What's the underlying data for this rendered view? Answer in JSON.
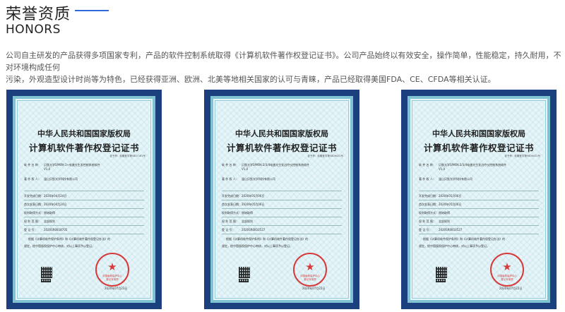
{
  "section": {
    "title_cn": "荣誉资质",
    "title_en": "HONORS",
    "accent_color": "#2f6bd8",
    "description_line1": "公司自主研发的产品获得多项国家专利，产品的软件控制系统取得《计算机软件著作权登记证书》。公司产品始终以有效安全，操作简单，性能稳定，持久耐用，不对环境构成任何",
    "description_line2": "污染，外观造型设计时尚等为特色，已经获得亚洲、欧洲、北美等地相关国家的认可与青睐，产品已经取得美国FDA、CE、CFDA等相关认证。"
  },
  "certificates": [
    {
      "org": "中华人民共和国国家版权局",
      "title": "计算机软件著作权登记证书",
      "reg_no": "证书号：软著登字第5807161号",
      "software_label": "软 件 名 称：",
      "software_name": "贝肽光学SPARK-1+电激光生发控制系统软件",
      "version": "V1.0",
      "owner_label": "著 作 权 人：",
      "owner": "温山贝肽光学科技有限公司",
      "dev_done_label": "开发完成日期：",
      "dev_done": "2020年04月24日",
      "first_pub_label": "首次发表日期：",
      "first_pub": "2020年04月24日",
      "acq_label": "权利取得方式：",
      "acq": "原始取得",
      "scope_label": "权 利 范 围：",
      "scope": "全部权利",
      "reg_num_label": "登 记 号：",
      "reg_num": "2020SR0818705",
      "para1": "根据《计算机软件保护条例》和《计算机软件著作权登记办法》的",
      "para2": "规定，经中国版权保护中心审核，对以上事项予以登记。",
      "seal_t1": "中国版权保护中心",
      "seal_t2": "登记专用章",
      "date": "2020年07月23日"
    },
    {
      "org": "中华人民共和国国家版权局",
      "title": "计算机软件著作权登记证书",
      "reg_no": "证书号：软著登字第5806022号",
      "software_label": "软 件 名 称：",
      "software_name": "贝肽光学SPARK-2/3/4电激光生发治疗仪控制系统软件",
      "version": "V1.0",
      "owner_label": "著 作 权 人：",
      "owner": "温山贝肽光学科技有限公司",
      "dev_done_label": "开发完成日期：",
      "dev_done": "2020年05月06日",
      "first_pub_label": "首次发表日期：",
      "first_pub": "2020年05月06日",
      "acq_label": "权利取得方式：",
      "acq": "原始取得",
      "scope_label": "权 利 范 围：",
      "scope": "全部权利",
      "reg_num_label": "登 记 号：",
      "reg_num": "2020SR0810527",
      "para1": "根据《计算机软件保护条例》和《计算机软件著作权登记办法》的",
      "para2": "规定，经中国版权保护中心审核，对以上事项予以登记。",
      "seal_t1": "中国版权保护中心",
      "seal_t2": "登记专用章",
      "date": "2020年07月22日"
    },
    {
      "org": "中华人民共和国国家版权局",
      "title": "计算机软件著作权登记证书",
      "reg_no": "证书号：软著登字第5806022号",
      "software_label": "软 件 名 称：",
      "software_name": "贝肽光学SPARK-2/3/4电激光生发治疗仪控制系统软件",
      "version": "V1.0",
      "owner_label": "著 作 权 人：",
      "owner": "温山贝肽光学科技有限公司",
      "dev_done_label": "开发完成日期：",
      "dev_done": "2020年05月06日",
      "first_pub_label": "首次发表日期：",
      "first_pub": "2020年05月06日",
      "acq_label": "权利取得方式：",
      "acq": "原始取得",
      "scope_label": "权 利 范 围：",
      "scope": "全部权利",
      "reg_num_label": "登 记 号：",
      "reg_num": "2020SR0810527",
      "para1": "根据《计算机软件保护条例》和《计算机软件著作权登记办法》的",
      "para2": "规定，经中国版权保护中心审核，对以上事项予以登记。",
      "seal_t1": "中国版权保护中心",
      "seal_t2": "登记专用章",
      "date": "2020年07月22日"
    }
  ]
}
